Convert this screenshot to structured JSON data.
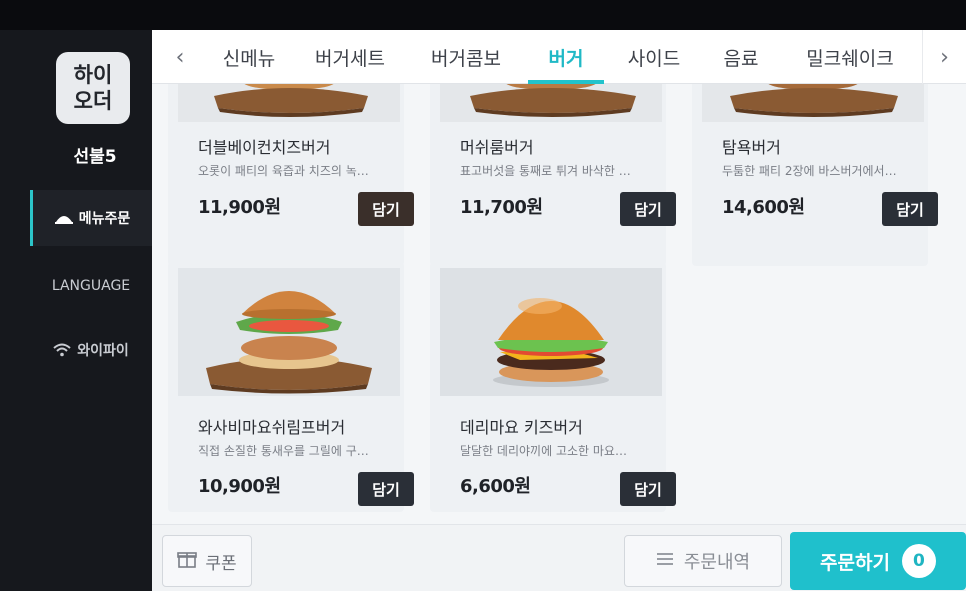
{
  "sidebar": {
    "logo_text": "하이\n오더",
    "table_name": "선불5",
    "items": [
      {
        "label": "메뉴주문",
        "icon": "cloche-icon",
        "active": true
      },
      {
        "label": "LANGUAGE",
        "active": false
      },
      {
        "label": "와이파이",
        "icon": "wifi-icon",
        "active": false
      }
    ]
  },
  "tabs": {
    "items": [
      {
        "label": "신메뉴"
      },
      {
        "label": "버거세트"
      },
      {
        "label": "버거콤보"
      },
      {
        "label": "버거",
        "active": true
      },
      {
        "label": "사이드"
      },
      {
        "label": "음료"
      },
      {
        "label": "밀크쉐이크"
      }
    ],
    "prev_icon": "chevron-left-icon",
    "next_icon": "chevron-right-icon"
  },
  "menu": {
    "add_label": "담기",
    "items": [
      {
        "name": "더블베이컨치즈버거",
        "desc": "오롯이 패티의 육즙과 치즈의 녹…",
        "price": "11,900원"
      },
      {
        "name": "머쉬룸버거",
        "desc": "표고버섯을 통째로 튀겨 바삭한 …",
        "price": "11,700원"
      },
      {
        "name": "탐욕버거",
        "desc": "두툼한 패티 2장에 바스버거에서…",
        "price": "14,600원"
      },
      {
        "name": "와사비마요쉬림프버거",
        "desc": "직접 손질한 통새우를 그릴에 구…",
        "price": "10,900원"
      },
      {
        "name": "데리마요 키즈버거",
        "desc": "달달한 데리야끼에 고소한 마요…",
        "price": "6,600원"
      }
    ]
  },
  "bottom": {
    "coupon_label": "쿠폰",
    "history_label": "주문내역",
    "order_label": "주문하기",
    "cart_count": "0"
  },
  "colors": {
    "accent": "#1fc0cc",
    "button_dark": "#2a2f37",
    "sidebar_bg": "#16181d"
  }
}
